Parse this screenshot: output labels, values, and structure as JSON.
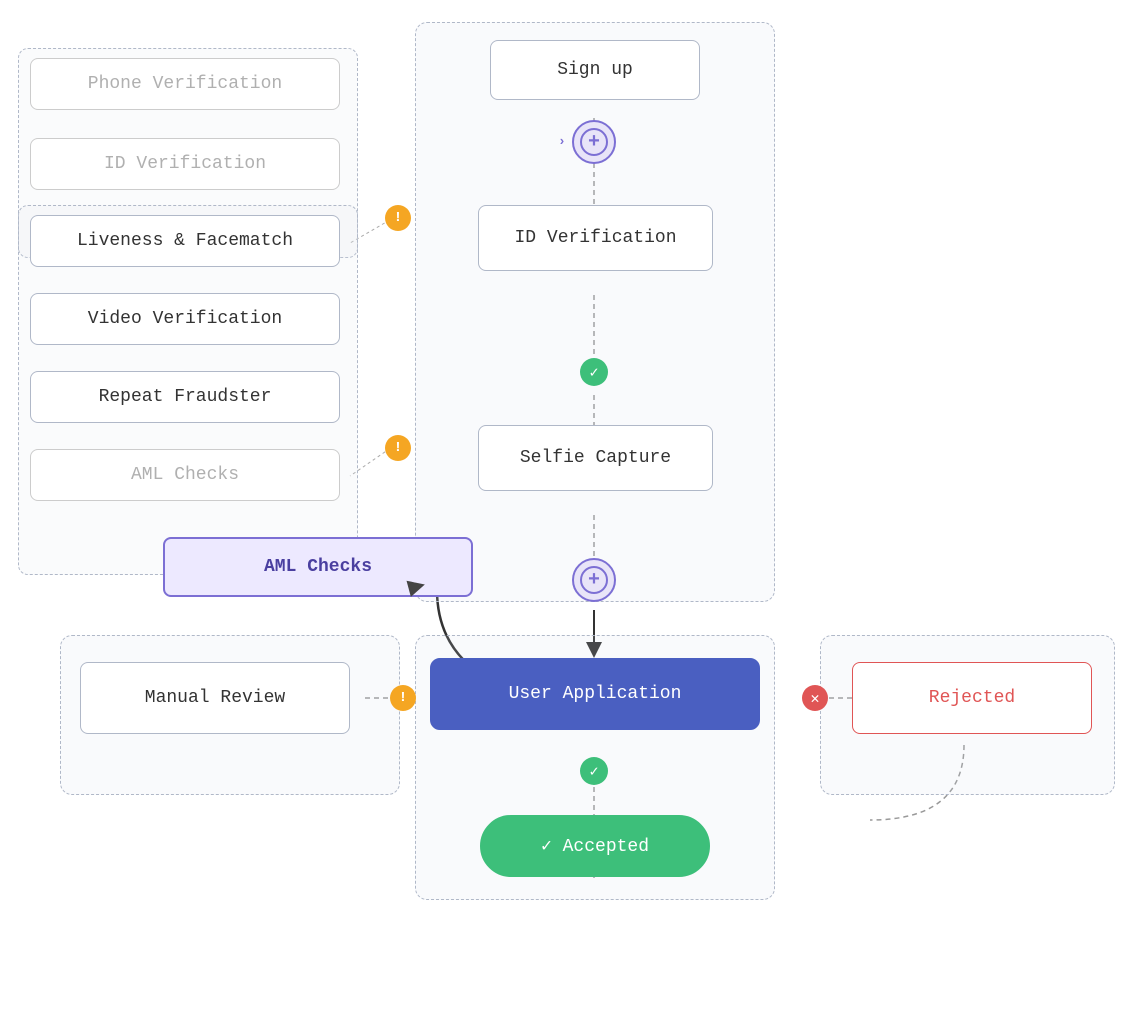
{
  "nodes": {
    "signup": {
      "label": "Sign up"
    },
    "id_verification_main": {
      "label": "ID Verification"
    },
    "selfie_capture": {
      "label": "Selfie Capture"
    },
    "user_application": {
      "label": "User Application"
    },
    "accepted": {
      "label": "✓  Accepted"
    },
    "manual_review": {
      "label": "Manual Review"
    },
    "rejected": {
      "label": "Rejected"
    },
    "aml_checks_drag": {
      "label": "AML Checks"
    }
  },
  "sidebar": {
    "phone_verification": {
      "label": "Phone Verification"
    },
    "id_verification": {
      "label": "ID Verification"
    },
    "liveness_facematch": {
      "label": "Liveness & Facematch"
    },
    "video_verification": {
      "label": "Video Verification"
    },
    "repeat_fraudster": {
      "label": "Repeat Fraudster"
    },
    "aml_checks": {
      "label": "AML Checks"
    }
  },
  "icons": {
    "plus": "+",
    "check": "✓",
    "warn": "!",
    "x": "✕"
  },
  "colors": {
    "active_blue": "#4a5fc1",
    "green": "#3dbf7a",
    "orange": "#f5a623",
    "red": "#e05555",
    "purple_light": "#ede9ff",
    "purple_border": "#7c6fd4",
    "node_border": "#b0b8c8",
    "region_bg": "rgba(210,215,235,0.18)"
  }
}
